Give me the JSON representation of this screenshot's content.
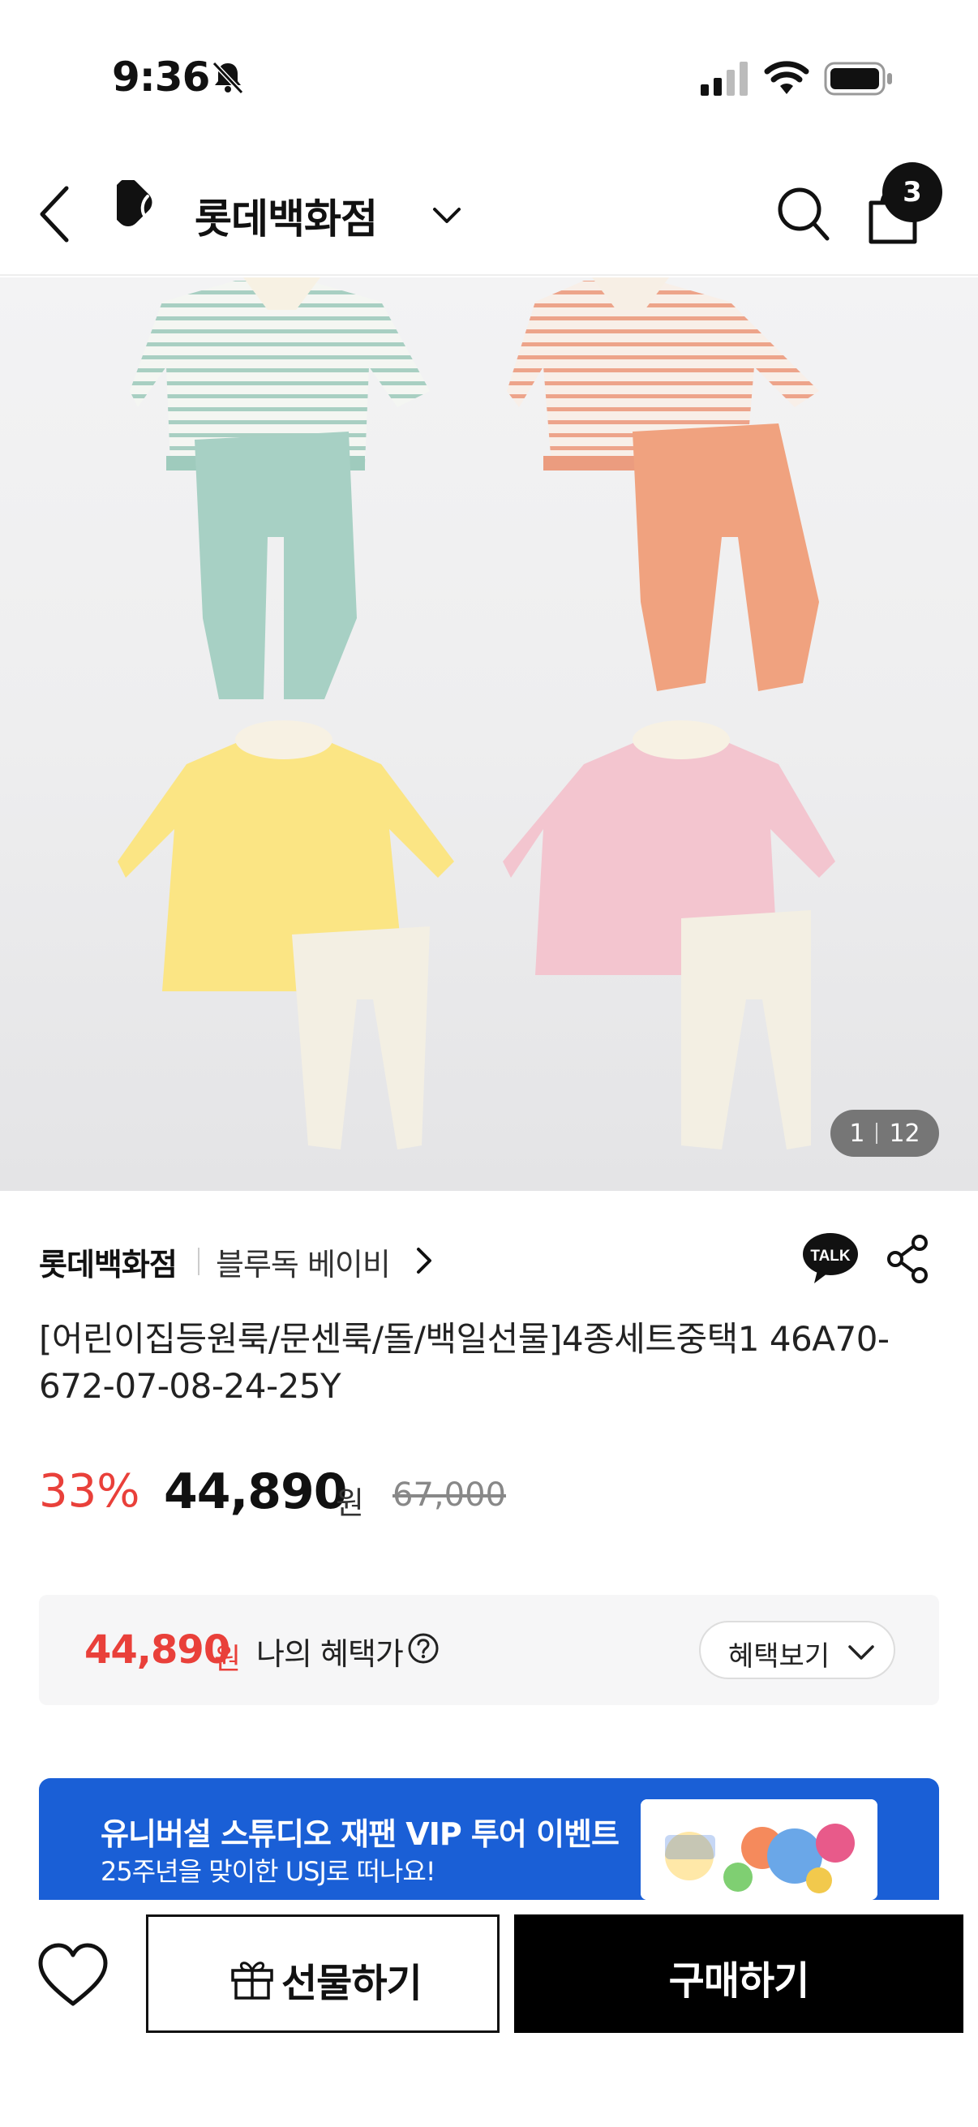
{
  "status_bar": {
    "time": "9:36",
    "icons": [
      "bell-slash-icon",
      "signal-icon",
      "wifi-icon",
      "battery-icon"
    ]
  },
  "header": {
    "brand": "롯데백화점",
    "cart_count": "3"
  },
  "gallery": {
    "current": "1",
    "total": "12"
  },
  "product": {
    "seller": "롯데백화점",
    "brand": "블루독 베이비",
    "title": "[어린이집등원룩/문센룩/돌/백일선물]4종세트중택1 46A70-672-07-08-24-25Y",
    "discount": "33%",
    "price": "44,890",
    "won": "원",
    "original_price": "67,000"
  },
  "benefit": {
    "price": "44,890",
    "won": "원",
    "label": "나의 혜택가",
    "button": "혜택보기"
  },
  "banner": {
    "title": "유니버설 스튜디오 재팬 VIP 투어 이벤트",
    "subtitle": "25주년을 맞이한 USJ로 떠나요!",
    "accent": "#1a5fd6"
  },
  "bottom": {
    "gift": "선물하기",
    "buy": "구매하기"
  },
  "colors": {
    "discount": "#e9403a",
    "primary": "#000000"
  }
}
